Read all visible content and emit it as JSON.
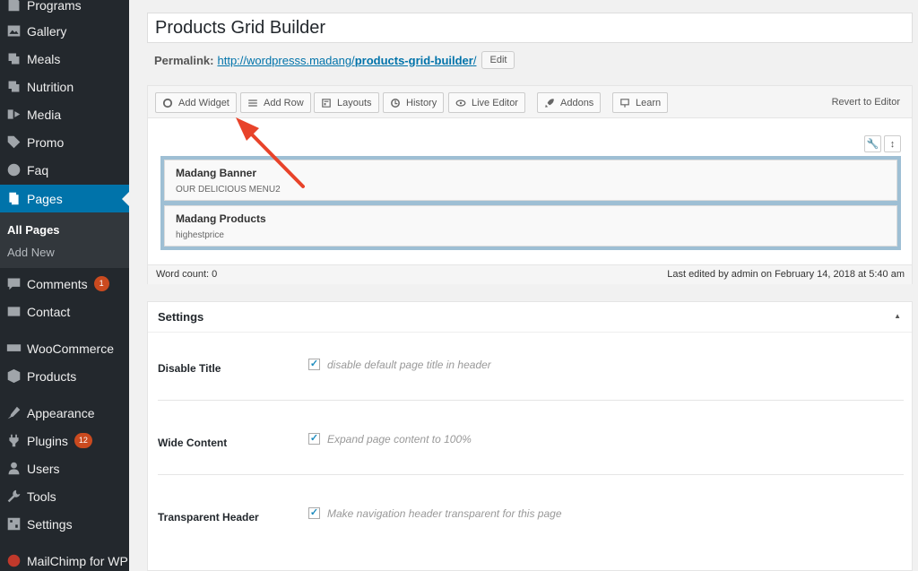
{
  "sidebar": {
    "items": [
      {
        "label": "Programs",
        "icon": "programs-icon",
        "badge": null
      },
      {
        "label": "Gallery",
        "icon": "gallery-icon",
        "badge": null
      },
      {
        "label": "Meals",
        "icon": "meals-icon",
        "badge": null
      },
      {
        "label": "Nutrition",
        "icon": "nutrition-icon",
        "badge": null
      },
      {
        "label": "Media",
        "icon": "media-icon",
        "badge": null
      },
      {
        "label": "Promo",
        "icon": "tag-icon",
        "badge": null
      },
      {
        "label": "Faq",
        "icon": "faq-icon",
        "badge": null
      },
      {
        "label": "Pages",
        "icon": "pages-icon",
        "badge": null
      },
      {
        "label": "Comments",
        "icon": "comments-icon",
        "badge": "1"
      },
      {
        "label": "Contact",
        "icon": "mail-icon",
        "badge": null
      },
      {
        "label": "WooCommerce",
        "icon": "woocommerce-icon",
        "badge": null
      },
      {
        "label": "Products",
        "icon": "products-icon",
        "badge": null
      },
      {
        "label": "Appearance",
        "icon": "appearance-icon",
        "badge": null
      },
      {
        "label": "Plugins",
        "icon": "plugins-icon",
        "badge": "12"
      },
      {
        "label": "Users",
        "icon": "users-icon",
        "badge": null
      },
      {
        "label": "Tools",
        "icon": "tools-icon",
        "badge": null
      },
      {
        "label": "Settings",
        "icon": "settings-icon",
        "badge": null
      },
      {
        "label": "MailChimp for WP",
        "icon": "mailchimp-icon",
        "badge": null
      }
    ],
    "submenu": [
      "All Pages",
      "Add New"
    ]
  },
  "page": {
    "title": "Products Grid Builder",
    "permalink_label": "Permalink:",
    "permalink_base": "http://wordpresss.madang/",
    "permalink_slug": "products-grid-builder",
    "permalink_tail": "/",
    "edit_label": "Edit"
  },
  "builder": {
    "toolbar": {
      "add_widget": "Add Widget",
      "add_row": "Add Row",
      "layouts": "Layouts",
      "history": "History",
      "live_editor": "Live Editor",
      "addons": "Addons",
      "learn": "Learn",
      "revert": "Revert to Editor"
    },
    "widgets": [
      {
        "title": "Madang Banner",
        "desc": "OUR DELICIOUS MENU2"
      },
      {
        "title": "Madang Products",
        "desc": "highestprice"
      }
    ],
    "word_count": "Word count: 0",
    "last_edited": "Last edited by admin on February 14, 2018 at 5:40 am"
  },
  "settings": {
    "title": "Settings",
    "rows": [
      {
        "label": "Disable Title",
        "desc": "disable default page title in header",
        "checked": true
      },
      {
        "label": "Wide Content",
        "desc": "Expand page content to 100%",
        "checked": true
      },
      {
        "label": "Transparent Header",
        "desc": "Make navigation header transparent for this page",
        "checked": true
      }
    ]
  },
  "colors": {
    "sidebar": "#23282d",
    "accent": "#0073aa",
    "badge": "#ca4a1f",
    "arrow": "#e8432a"
  }
}
